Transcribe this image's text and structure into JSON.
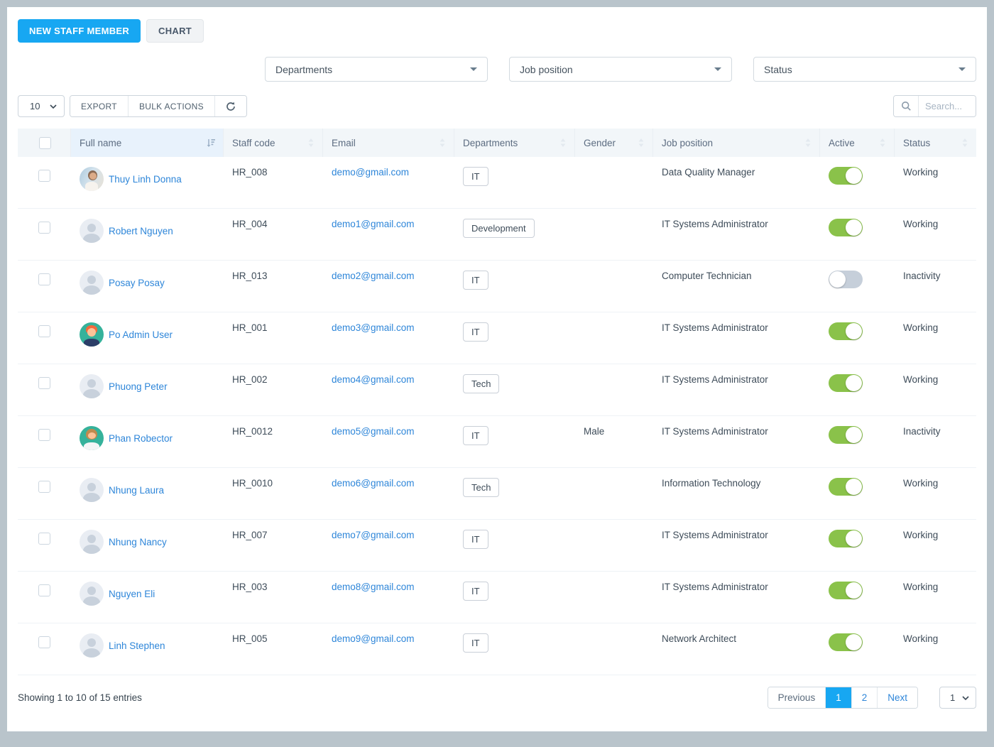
{
  "toolbar": {
    "new_staff_label": "NEW STAFF MEMBER",
    "chart_label": "CHART"
  },
  "filters": [
    {
      "label": "Departments"
    },
    {
      "label": "Job position"
    },
    {
      "label": "Status"
    }
  ],
  "controls": {
    "page_size": "10",
    "export_label": "EXPORT",
    "bulk_actions_label": "BULK ACTIONS",
    "search_placeholder": "Search..."
  },
  "icons": {
    "refresh": "circular-arrows",
    "search": "magnifier",
    "sort_active": "sort-amount-down",
    "sort_inactive": "up-down-arrows",
    "select_caret": "triangle-down",
    "select_chevron": "chevron-down"
  },
  "table": {
    "headers": [
      "Full name",
      "Staff code",
      "Email",
      "Departments",
      "Gender",
      "Job position",
      "Active",
      "Status"
    ],
    "sorted_column": "Full name",
    "rows": [
      {
        "name": "Thuy Linh Donna",
        "staff_code": "HR_008",
        "email": "demo@gmail.com",
        "department": "IT",
        "gender": "",
        "job_position": "Data Quality Manager",
        "active": true,
        "status": "Working",
        "avatar": "photo"
      },
      {
        "name": "Robert Nguyen",
        "staff_code": "HR_004",
        "email": "demo1@gmail.com",
        "department": "Development",
        "gender": "",
        "job_position": "IT Systems Administrator",
        "active": true,
        "status": "Working",
        "avatar": "default"
      },
      {
        "name": "Posay Posay",
        "staff_code": "HR_013",
        "email": "demo2@gmail.com",
        "department": "IT",
        "gender": "",
        "job_position": "Computer Technician",
        "active": false,
        "status": "Inactivity",
        "avatar": "default"
      },
      {
        "name": "Po Admin User",
        "staff_code": "HR_001",
        "email": "demo3@gmail.com",
        "department": "IT",
        "gender": "",
        "job_position": "IT Systems Administrator",
        "active": true,
        "status": "Working",
        "avatar": "cartoon-male"
      },
      {
        "name": "Phuong Peter",
        "staff_code": "HR_002",
        "email": "demo4@gmail.com",
        "department": "Tech",
        "gender": "",
        "job_position": "IT Systems Administrator",
        "active": true,
        "status": "Working",
        "avatar": "default"
      },
      {
        "name": "Phan Robector",
        "staff_code": "HR_0012",
        "email": "demo5@gmail.com",
        "department": "IT",
        "gender": "Male",
        "job_position": "IT Systems Administrator",
        "active": true,
        "status": "Inactivity",
        "avatar": "cartoon-beard"
      },
      {
        "name": "Nhung Laura",
        "staff_code": "HR_0010",
        "email": "demo6@gmail.com",
        "department": "Tech",
        "gender": "",
        "job_position": "Information Technology",
        "active": true,
        "status": "Working",
        "avatar": "default"
      },
      {
        "name": "Nhung Nancy",
        "staff_code": "HR_007",
        "email": "demo7@gmail.com",
        "department": "IT",
        "gender": "",
        "job_position": "IT Systems Administrator",
        "active": true,
        "status": "Working",
        "avatar": "default"
      },
      {
        "name": "Nguyen Eli",
        "staff_code": "HR_003",
        "email": "demo8@gmail.com",
        "department": "IT",
        "gender": "",
        "job_position": "IT Systems Administrator",
        "active": true,
        "status": "Working",
        "avatar": "default"
      },
      {
        "name": "Linh Stephen",
        "staff_code": "HR_005",
        "email": "demo9@gmail.com",
        "department": "IT",
        "gender": "",
        "job_position": "Network Architect",
        "active": true,
        "status": "Working",
        "avatar": "default"
      }
    ]
  },
  "footer": {
    "showing_text": "Showing 1 to 10 of 15 entries",
    "pagination": {
      "previous": "Previous",
      "pages": [
        "1",
        "2"
      ],
      "active_page": "1",
      "next": "Next",
      "page_select": "1"
    }
  },
  "colors": {
    "primary_blue": "#17a7f2",
    "link_blue": "#2e86d9",
    "toggle_on_green": "#8ac24a",
    "toggle_off_gray": "#c6cfda",
    "header_bg": "#f2f6f9",
    "sorted_header_bg": "#e8f2fc"
  }
}
